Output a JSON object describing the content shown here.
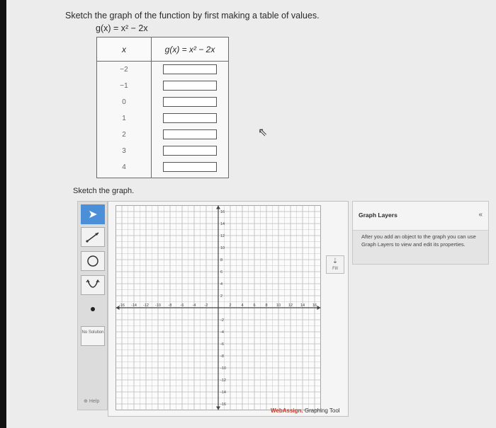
{
  "problem": {
    "prompt": "Sketch the graph of the function by first making a table of values.",
    "function": "g(x) = x² − 2x"
  },
  "table": {
    "x_header": "x",
    "g_header": "g(x) = x² − 2x",
    "x_values": [
      "−2",
      "−1",
      "0",
      "1",
      "2",
      "3",
      "4"
    ],
    "answers": [
      "",
      "",
      "",
      "",
      "",
      "",
      ""
    ]
  },
  "sketch_label": "Sketch the graph.",
  "toolbox": {
    "tools": [
      "pointer-icon",
      "line-segment-icon",
      "circle-icon",
      "parabola-icon",
      "point-icon"
    ],
    "no_solution_label": "No Solution",
    "help_label": "Help"
  },
  "graph": {
    "x_tick_labels": [
      "-16",
      "-14",
      "-12",
      "-10",
      "-8",
      "-6",
      "-4",
      "-2",
      "2",
      "4",
      "6",
      "8",
      "10",
      "12",
      "14",
      "16"
    ],
    "y_tick_labels": [
      "16",
      "14",
      "12",
      "10",
      "8",
      "6",
      "4",
      "2",
      "-2",
      "-4",
      "-6",
      "-8",
      "-10",
      "-12",
      "-14",
      "-16"
    ],
    "fill_label": "Fill",
    "brand_name": "WebAssign.",
    "brand_tool": "Graphing Tool"
  },
  "layers_panel": {
    "title": "Graph Layers",
    "collapse_symbol": "«",
    "description": "After you add an object to the graph you can use Graph Layers to view and edit its properties."
  },
  "colors": {
    "active_tool": "#4a8fd8",
    "brand_red": "#c0392b",
    "grid": "#b9b9b9"
  }
}
